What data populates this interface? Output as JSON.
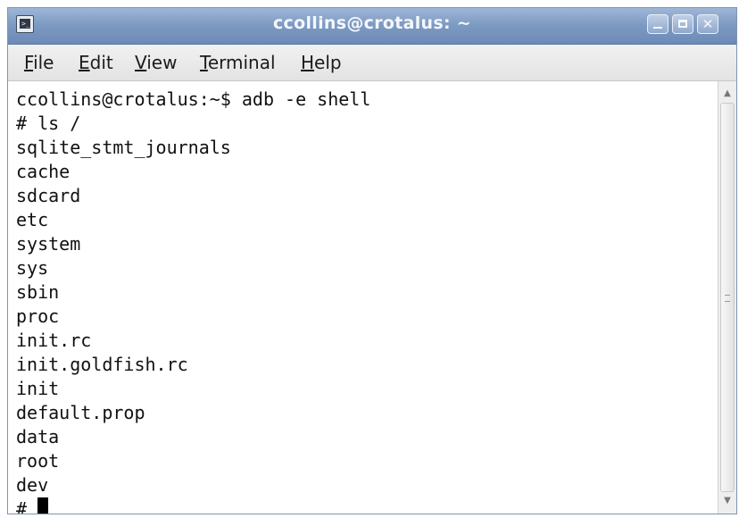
{
  "window": {
    "title": "ccollins@crotalus: ~"
  },
  "icons": {
    "window_icon": "terminal-icon",
    "minimize": "minimize-icon",
    "maximize": "maximize-icon",
    "close": "close-icon",
    "close_glyph": "✕"
  },
  "menu": {
    "items": [
      {
        "mnemonic": "F",
        "rest": "ile"
      },
      {
        "mnemonic": "E",
        "rest": "dit"
      },
      {
        "mnemonic": "V",
        "rest": "iew"
      },
      {
        "mnemonic": "T",
        "rest": "erminal"
      },
      {
        "mnemonic": "H",
        "rest": "elp"
      }
    ]
  },
  "terminal": {
    "lines": [
      "ccollins@crotalus:~$ adb -e shell",
      "# ls /",
      "sqlite_stmt_journals",
      "cache",
      "sdcard",
      "etc",
      "system",
      "sys",
      "sbin",
      "proc",
      "init.rc",
      "init.goldfish.rc",
      "init",
      "default.prop",
      "data",
      "root",
      "dev"
    ],
    "prompt": "#"
  },
  "colors": {
    "titlebar": "#7e9bc3",
    "terminal_bg": "#ffffff",
    "terminal_fg": "#111111"
  }
}
